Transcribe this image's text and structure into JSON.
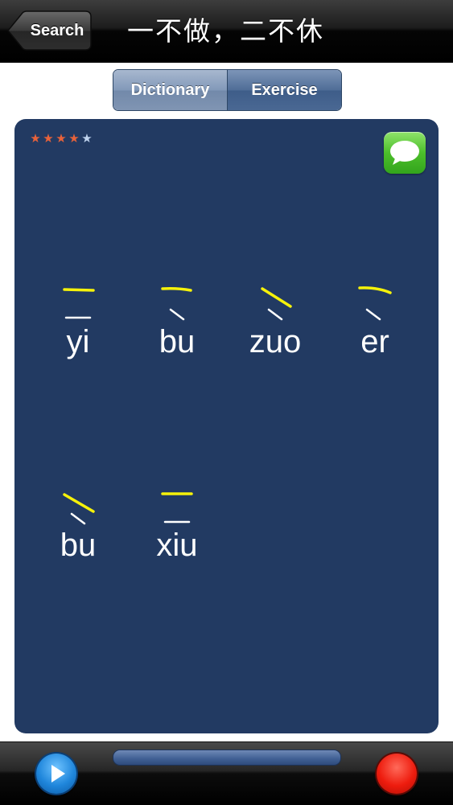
{
  "nav": {
    "back_label": "Search",
    "title": "一不做，二不休"
  },
  "segments": [
    {
      "label": "Dictionary",
      "selected": false
    },
    {
      "label": "Exercise",
      "selected": true
    }
  ],
  "card": {
    "rating": {
      "filled": 4,
      "total": 5
    },
    "message_icon": "speech-bubble-icon",
    "syllables": [
      {
        "pinyin": "yi",
        "tone": 1,
        "tone_mark": "first-tone-flat"
      },
      {
        "pinyin": "bu",
        "tone": 4,
        "tone_mark": "fourth-tone-falling"
      },
      {
        "pinyin": "zuo",
        "tone": 4,
        "tone_mark": "fourth-tone-falling"
      },
      {
        "pinyin": "er",
        "tone": 4,
        "tone_mark": "fourth-tone-falling"
      },
      {
        "pinyin": "bu",
        "tone": 4,
        "tone_mark": "fourth-tone-falling"
      },
      {
        "pinyin": "xiu",
        "tone": 1,
        "tone_mark": "first-tone-flat"
      }
    ]
  },
  "toolbar": {
    "play_icon": "play-icon",
    "progress": 0,
    "record_icon": "record-icon"
  },
  "colors": {
    "card_background": "#223a62",
    "user_stroke": "#f6f20a",
    "tone_mark": "#ffffff",
    "star_filled": "#e8623a",
    "star_empty": "#bfd3ee",
    "play": "#1f86db",
    "record": "#ee1c0e",
    "message": "#4cbf2b"
  }
}
